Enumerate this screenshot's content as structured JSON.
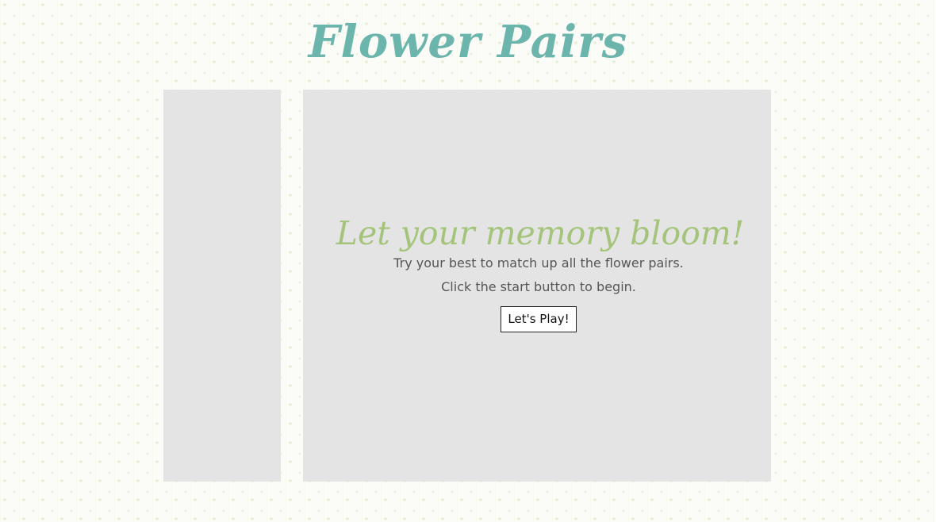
{
  "header": {
    "title": "Flower Pairs"
  },
  "intro": {
    "tagline": "Let your memory bloom!",
    "line1": "Try your best to match up all the flower pairs.",
    "line2": "Click the start button to begin.",
    "start_label": "Let's Play!"
  },
  "colors": {
    "title": "#6cb5ad",
    "tagline": "#a3c47a",
    "panel": "#e4e4e4",
    "body_text": "#555555"
  }
}
